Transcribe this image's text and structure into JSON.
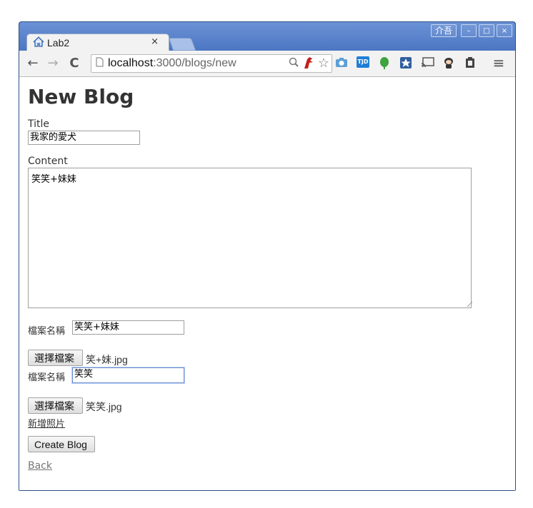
{
  "window": {
    "ime_label": "介吾",
    "min_glyph": "–",
    "max_glyph": "□",
    "close_glyph": "×"
  },
  "tab": {
    "title": "Lab2",
    "close_glyph": "×"
  },
  "toolbar": {
    "back_glyph": "←",
    "forward_glyph": "→",
    "reload_glyph": "C",
    "url_host": "localhost",
    "url_path": ":3000/blogs/new",
    "ext_tjd_label": "TJD",
    "menu_glyph": "≡"
  },
  "page": {
    "heading": "New Blog",
    "title_label": "Title",
    "title_value": "我家的愛犬",
    "content_label": "Content",
    "content_value": "笑笑+妹妹",
    "photos": [
      {
        "name_label": "檔案名稱",
        "name_value": "笑笑+妹妹",
        "choose_label": "選擇檔案",
        "file_name": "笑+妹.jpg"
      },
      {
        "name_label": "檔案名稱",
        "name_value": "笑笑",
        "choose_label": "選擇檔案",
        "file_name": "笑笑.jpg"
      }
    ],
    "add_photo_label": "新增照片",
    "submit_label": "Create Blog",
    "back_label": "Back"
  }
}
